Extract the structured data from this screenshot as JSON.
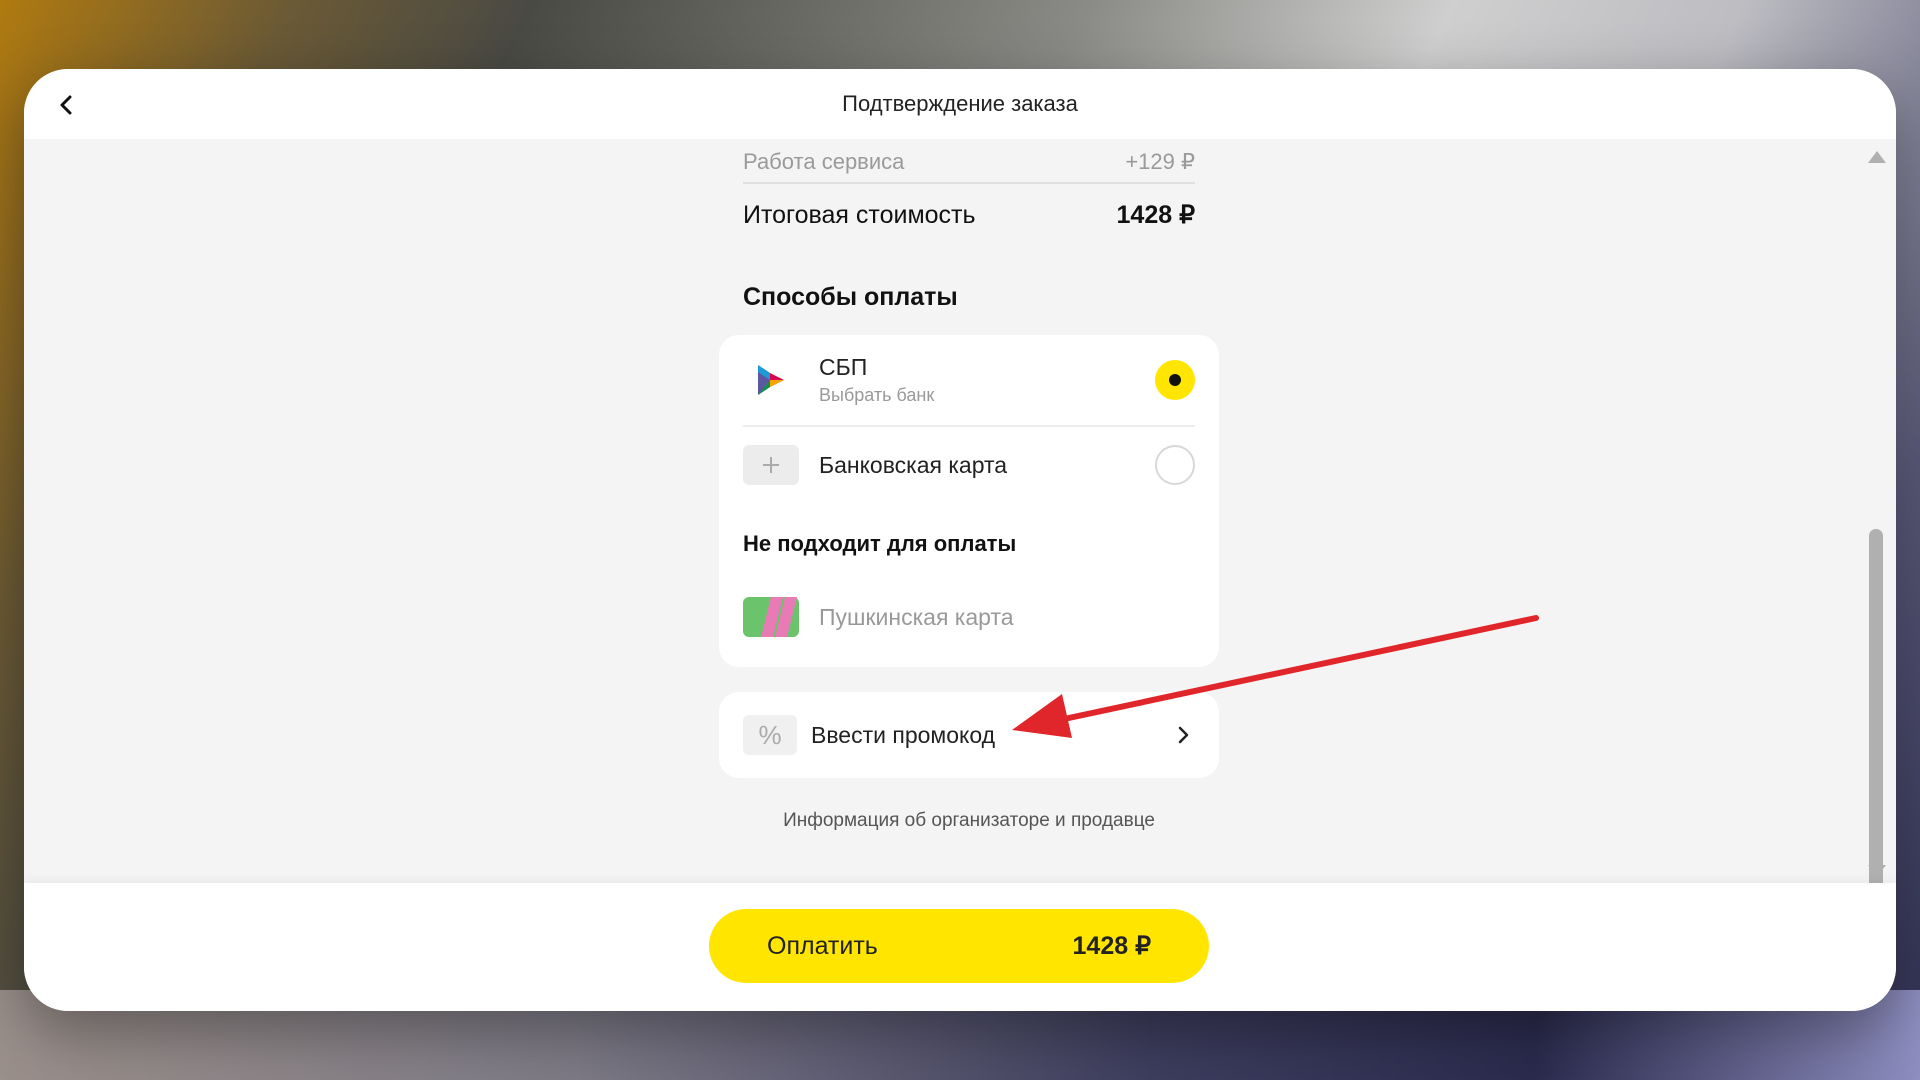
{
  "header": {
    "title": "Подтверждение заказа",
    "back_icon": "chevron-left-icon"
  },
  "summary": {
    "service_label": "Работа сервиса",
    "service_value": "+129 ₽",
    "total_label": "Итоговая стоимость",
    "total_value": "1428 ₽"
  },
  "payment": {
    "section_title": "Способы оплаты",
    "methods": [
      {
        "name": "СБП",
        "sub": "Выбрать банк",
        "icon": "sbp-icon",
        "selected": true
      },
      {
        "name": "Банковская карта",
        "icon": "plus-icon",
        "selected": false
      }
    ],
    "unavailable_title": "Не подходит для оплаты",
    "unavailable": [
      {
        "name": "Пушкинская карта",
        "icon": "pushkin-card-icon"
      }
    ]
  },
  "promo": {
    "label": "Ввести промокод",
    "icon": "percent-icon"
  },
  "info_link": "Информация об организаторе и продавце",
  "footer": {
    "pay_label": "Оплатить",
    "pay_amount": "1428 ₽"
  },
  "colors": {
    "accent": "#ffe500",
    "annotation_arrow": "#e0262a"
  }
}
